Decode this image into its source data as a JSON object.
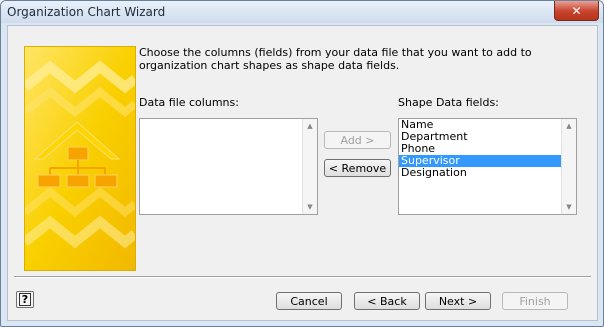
{
  "window": {
    "title": "Organization Chart Wizard",
    "close_glyph": "✕"
  },
  "banner": {
    "icon": "organization-chart-illustration",
    "colors": {
      "primary": "#f6c400",
      "light": "#ffe566",
      "shape": "#f7a400"
    }
  },
  "instruction": "Choose the columns (fields) from your data file that you want to add to organization chart shapes as shape data fields.",
  "data_file_columns": {
    "label": "Data file columns:",
    "items": []
  },
  "shape_data_fields": {
    "label": "Shape Data fields:",
    "items": [
      {
        "text": "Name",
        "selected": false
      },
      {
        "text": "Department",
        "selected": false
      },
      {
        "text": "Phone",
        "selected": false
      },
      {
        "text": "Supervisor",
        "selected": true
      },
      {
        "text": "Designation",
        "selected": false
      }
    ]
  },
  "buttons": {
    "add": "Add >",
    "remove": "< Remove",
    "cancel": "Cancel",
    "back": "< Back",
    "next": "Next >",
    "finish": "Finish"
  },
  "help_glyph": "?",
  "colors": {
    "selection": "#3399ff",
    "title_close": "#c8412b"
  }
}
